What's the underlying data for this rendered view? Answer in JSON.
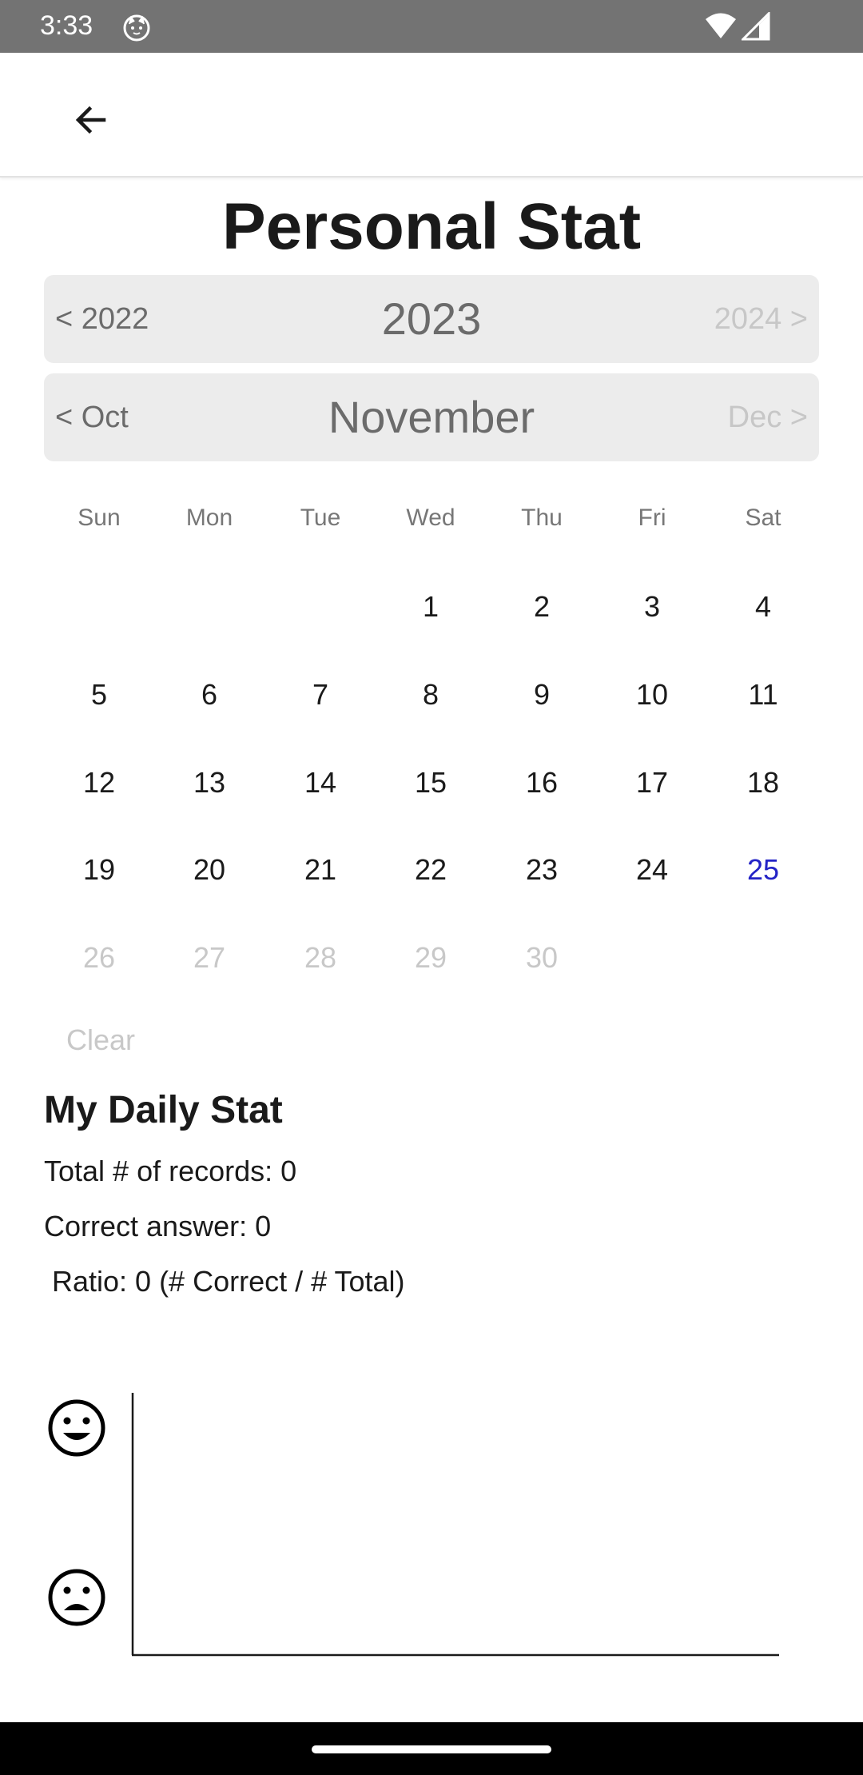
{
  "status_bar": {
    "time": "3:33"
  },
  "page": {
    "title": "Personal Stat"
  },
  "year_nav": {
    "prev": "< 2022",
    "current": "2023",
    "next": "2024 >"
  },
  "month_nav": {
    "prev": "< Oct",
    "current": "November",
    "next": "Dec >"
  },
  "calendar": {
    "weekdays": [
      "Sun",
      "Mon",
      "Tue",
      "Wed",
      "Thu",
      "Fri",
      "Sat"
    ],
    "first_weekday_index": 3,
    "days": [
      "1",
      "2",
      "3",
      "4",
      "5",
      "6",
      "7",
      "8",
      "9",
      "10",
      "11",
      "12",
      "13",
      "14",
      "15",
      "16",
      "17",
      "18",
      "19",
      "20",
      "21",
      "22",
      "23",
      "24",
      "25",
      "26",
      "27",
      "28",
      "29",
      "30"
    ],
    "today": "25",
    "clear_label": "Clear"
  },
  "stats": {
    "title": "My Daily Stat",
    "total_records": "Total # of records: 0",
    "correct_answer": "Correct answer: 0",
    "ratio": " Ratio: 0 (# Correct / # Total)"
  },
  "chart_data": {
    "type": "line",
    "series": [],
    "y_axis_icons": [
      "smiling-face-icon",
      "frowning-face-icon"
    ],
    "grid": false
  },
  "colors": {
    "today": "#2323c6",
    "future_day": "#c8c8c8",
    "nav_bar_bg": "#ececec",
    "status_bar_bg": "#737373"
  }
}
